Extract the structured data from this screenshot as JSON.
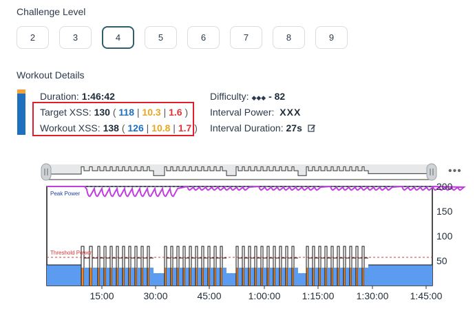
{
  "challenge": {
    "title": "Challenge Level",
    "levels": [
      "2",
      "3",
      "4",
      "5",
      "6",
      "7",
      "8",
      "9"
    ],
    "selected": "4"
  },
  "workout": {
    "title": "Workout Details",
    "duration_label": "Duration:",
    "duration_value": "1:46:42",
    "target_label": "Target XSS:",
    "target_total": "130",
    "target_low": "118",
    "target_high": "10.3",
    "target_peak": "1.6",
    "workout_label": "Workout XSS:",
    "workout_total": "138",
    "workout_low": "126",
    "workout_high": "10.8",
    "workout_peak": "1.7",
    "difficulty_label": "Difficulty:",
    "difficulty_icons": "◆◆◆",
    "difficulty_value": "- 82",
    "interval_power_label": "Interval Power:",
    "interval_power_value": "XXX",
    "interval_duration_label": "Interval Duration:",
    "interval_duration_value": "27s"
  },
  "colors": {
    "low": "#1f6fbf",
    "high": "#e8a51f",
    "peak": "#e03434",
    "peak_power_line": "#c23de0",
    "area_fill": "#5b9bf0",
    "accent_bar": "#f2a23a"
  },
  "chart_data": {
    "type": "area",
    "peak_label": "Peak Power",
    "threshold_label": "Threshold Power",
    "x_ticks": [
      "15:00",
      "30:00",
      "45:00",
      "1:00:00",
      "1:15:00",
      "1:30:00",
      "1:45:00"
    ],
    "y_ticks": [
      "200",
      "150",
      "100",
      "50"
    ],
    "ylim": [
      0,
      200
    ],
    "threshold_value": 57,
    "peak_power_level": 200
  }
}
